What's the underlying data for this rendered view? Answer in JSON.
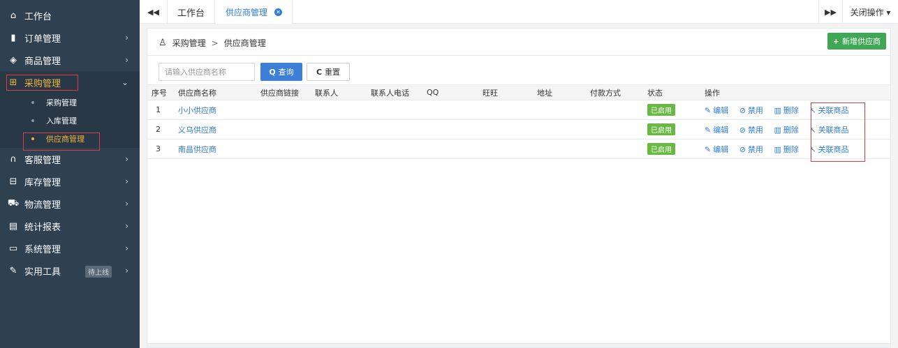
{
  "sidebar": {
    "items": [
      {
        "label": "工作台",
        "icon": "home-icon",
        "glyph": "⌂",
        "has_children": false
      },
      {
        "label": "订单管理",
        "icon": "clipboard-icon",
        "glyph": "▮",
        "has_children": true
      },
      {
        "label": "商品管理",
        "icon": "cube-icon",
        "glyph": "◈",
        "has_children": true
      },
      {
        "label": "采购管理",
        "icon": "cart-icon",
        "glyph": "⊞",
        "has_children": true,
        "active": true
      },
      {
        "label": "客服管理",
        "icon": "headphones-icon",
        "glyph": "∩",
        "has_children": true
      },
      {
        "label": "库存管理",
        "icon": "inbox-icon",
        "glyph": "⊟",
        "has_children": true
      },
      {
        "label": "物流管理",
        "icon": "truck-icon",
        "glyph": "⛟",
        "has_children": true
      },
      {
        "label": "统计报表",
        "icon": "report-icon",
        "glyph": "▤",
        "has_children": true
      },
      {
        "label": "系统管理",
        "icon": "monitor-icon",
        "glyph": "▭",
        "has_children": true
      },
      {
        "label": "实用工具",
        "icon": "wrench-icon",
        "glyph": "✎",
        "has_children": true,
        "badge": "待上线"
      }
    ],
    "submenu": [
      {
        "label": "采购管理"
      },
      {
        "label": "入库管理"
      },
      {
        "label": "供应商管理",
        "active": true
      }
    ],
    "chevron_right": "›",
    "chevron_down": "⌄"
  },
  "tabs": {
    "nav_left": "◀◀",
    "items": [
      {
        "label": "工作台"
      },
      {
        "label": "供应商管理",
        "closable": true
      }
    ],
    "close_glyph": "✕",
    "nav_right": "▶▶",
    "close_ops": "关闭操作 ▾"
  },
  "page": {
    "breadcrumb": {
      "icon": "user-tie-icon",
      "glyph": "♙",
      "parent": "采购管理",
      "sep": ">",
      "current": "供应商管理"
    },
    "add_button": {
      "plus": "+",
      "label": "新增供应商"
    },
    "search": {
      "placeholder": "请输入供应商名称",
      "value": ""
    },
    "query_button": {
      "icon": "Q",
      "label": "查询"
    },
    "reset_button": {
      "icon": "C",
      "label": "重置"
    }
  },
  "table": {
    "headers": [
      "序号",
      "供应商名称",
      "供应商链接",
      "联系人",
      "联系人电话",
      "QQ",
      "旺旺",
      "地址",
      "付款方式",
      "状态",
      "操作"
    ],
    "rows": [
      {
        "no": "1",
        "name": "小小供应商",
        "status": "已启用"
      },
      {
        "no": "2",
        "name": "义乌供应商",
        "status": "已启用"
      },
      {
        "no": "3",
        "name": "南昌供应商",
        "status": "已启用"
      }
    ],
    "actions": {
      "edit": "编辑",
      "edit_glyph": "✎",
      "disable": "禁用",
      "disable_glyph": "⊘",
      "delete": "删除",
      "delete_glyph": "▥",
      "relate": "关联商品",
      "relate_glyph": "↖"
    }
  },
  "colors": {
    "sidebar_bg": "#2f4050",
    "active_text": "#f1b53b",
    "link": "#2e7eda",
    "status_green": "#67b942",
    "add_green": "#3ea855",
    "highlight_red": "#e4393c"
  }
}
